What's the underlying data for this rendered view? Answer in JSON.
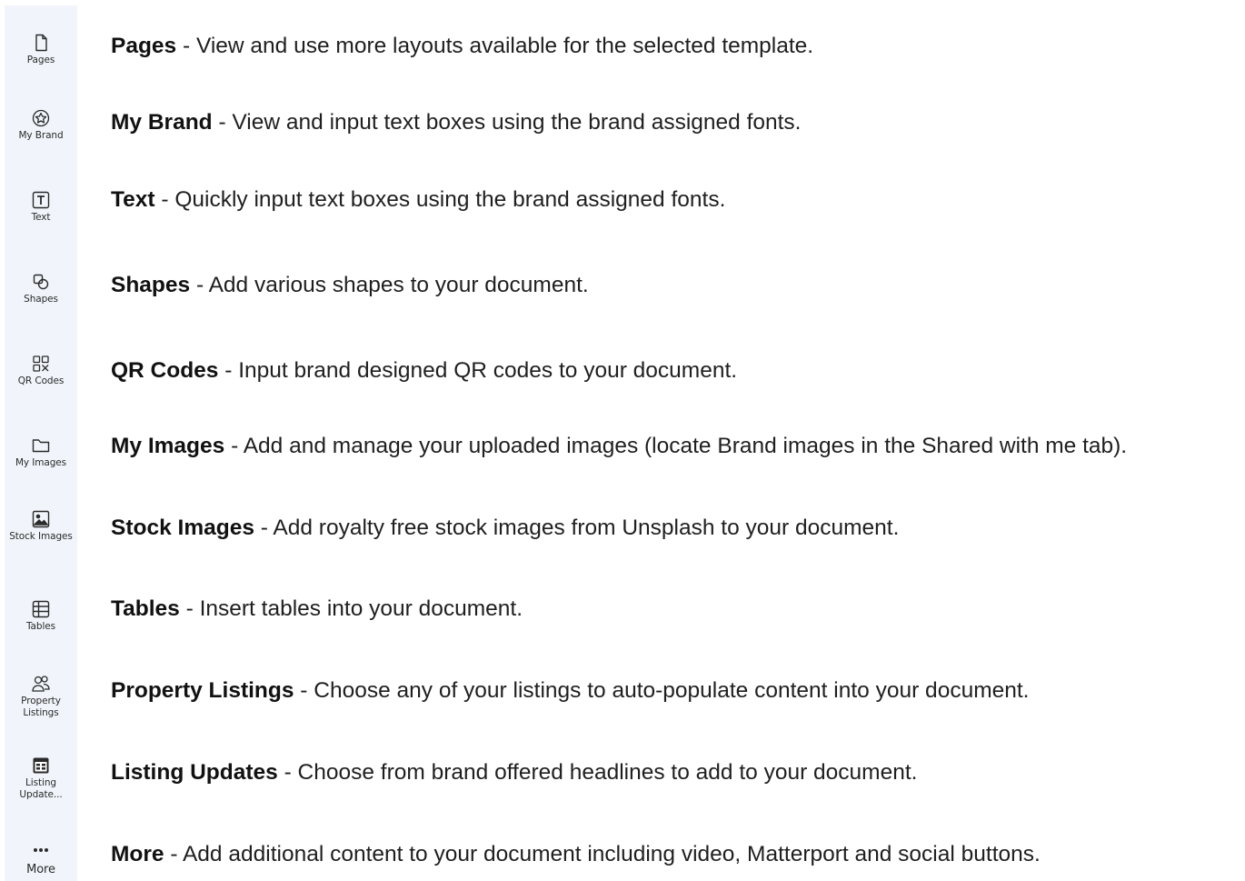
{
  "sidebar": {
    "items": [
      {
        "label": "Pages",
        "icon": "page-icon"
      },
      {
        "label": "My Brand",
        "icon": "brand-icon"
      },
      {
        "label": "Text",
        "icon": "text-icon"
      },
      {
        "label": "Shapes",
        "icon": "shapes-icon"
      },
      {
        "label": "QR Codes",
        "icon": "qr-code-icon"
      },
      {
        "label": "My Images",
        "icon": "folder-icon"
      },
      {
        "label": "Stock Images",
        "icon": "image-icon"
      },
      {
        "label": "Tables",
        "icon": "table-icon"
      },
      {
        "label": "Property Listings",
        "icon": "people-icon"
      },
      {
        "label": "Listing Update...",
        "icon": "calendar-icon"
      },
      {
        "label": "More",
        "icon": "more-dots-icon"
      }
    ]
  },
  "descriptions": [
    {
      "title": "Pages",
      "text": " - View and use more layouts available for the selected template."
    },
    {
      "title": "My Brand",
      "text": " - View and input text boxes using the brand assigned fonts."
    },
    {
      "title": "Text",
      "text": " - Quickly input text boxes using the brand assigned fonts."
    },
    {
      "title": "Shapes",
      "text": " - Add various shapes to your document."
    },
    {
      "title": "QR Codes",
      "text": " - Input brand designed QR codes to your document."
    },
    {
      "title": "My Images",
      "text": " - Add and manage your uploaded images (locate Brand images in the Shared with me tab)."
    },
    {
      "title": "Stock Images",
      "text": " - Add royalty free stock images from Unsplash to your document."
    },
    {
      "title": "Tables",
      "text": " - Insert tables into your document."
    },
    {
      "title": "Property Listings",
      "text": " - Choose any of your listings to auto-populate content into your document."
    },
    {
      "title": "Listing Updates",
      "text": " - Choose from brand offered headlines to add to your document."
    },
    {
      "title": "More",
      "text": " - Add additional content to your document including video, Matterport and social buttons."
    }
  ],
  "colors": {
    "sidebar_bg": "#f1f5fb",
    "icon": "#2a2a2a",
    "text": "#1f1f1f"
  }
}
